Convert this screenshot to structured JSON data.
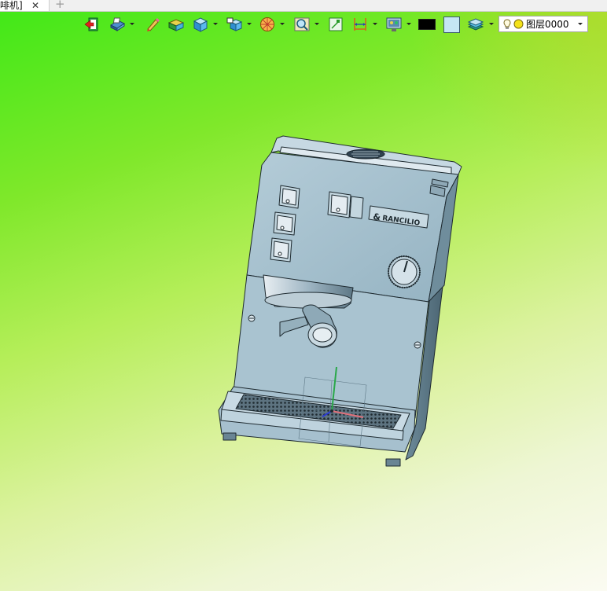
{
  "tab": {
    "title": "啡机]",
    "close": "✕",
    "add": "+"
  },
  "toolbar": {
    "items": [
      {
        "name": "exit-icon"
      },
      {
        "name": "print-icon",
        "dropdown": true
      },
      {
        "name": "pen-sketch-icon"
      },
      {
        "name": "solid-box-icon"
      },
      {
        "name": "cube-icon",
        "dropdown": true
      },
      {
        "name": "part-cube-icon",
        "dropdown": true
      },
      {
        "name": "render-sphere-icon",
        "dropdown": true
      },
      {
        "name": "view-zoom-icon",
        "dropdown": true
      },
      {
        "name": "fit-view-icon"
      },
      {
        "name": "dimension-icon",
        "dropdown": true
      },
      {
        "name": "display-settings-icon",
        "dropdown": true
      },
      {
        "name": "color-black-swatch"
      },
      {
        "name": "color-lightblue-swatch"
      },
      {
        "name": "layers-icon",
        "dropdown": true
      }
    ],
    "layer_select": {
      "value": "图层0000"
    }
  },
  "model": {
    "brand": "RANCILIO",
    "body_color": "#a8c4d2",
    "line_color": "#1e2a30"
  },
  "colors": {
    "background_top": "#3ee817",
    "background_bottom": "#fbfbf2",
    "swatch_black": "#000000",
    "swatch_lightblue": "#c4e6f4"
  }
}
